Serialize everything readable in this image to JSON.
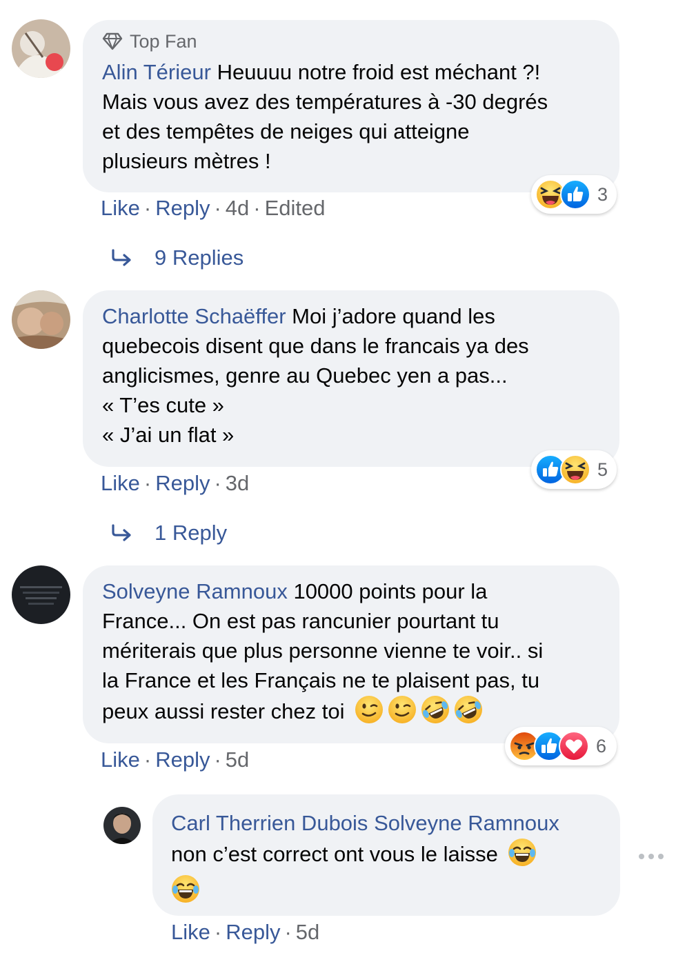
{
  "comments": [
    {
      "badge": "Top Fan",
      "author": "Alin Térieur",
      "text_lines": [
        "Heuuuu notre froid est méchant ?!",
        "Mais vous avez des températures à -30 degrés",
        "et des tempêtes de neiges qui atteigne",
        "plusieurs mètres !"
      ],
      "actions": {
        "like": "Like",
        "reply": "Reply",
        "time": "4d",
        "edited": "Edited"
      },
      "reactions": {
        "icons": [
          "haha-icon",
          "like-icon"
        ],
        "count": "3"
      },
      "replies_label": "9 Replies"
    },
    {
      "author": "Charlotte Schaëffer",
      "text_lines": [
        "Moi j’adore quand les",
        "quebecois disent que dans le francais ya des",
        "anglicismes, genre au Quebec yen a pas...",
        "« T’es cute »",
        "« J’ai un flat »"
      ],
      "actions": {
        "like": "Like",
        "reply": "Reply",
        "time": "3d"
      },
      "reactions": {
        "icons": [
          "like-icon",
          "haha-icon"
        ],
        "count": "5"
      },
      "replies_label": "1 Reply"
    },
    {
      "author": "Solveyne Ramnoux",
      "text_lines": [
        "10000 points pour la",
        "France... On est pas rancunier pourtant tu",
        "mériterais que plus personne vienne te voir.. si",
        "la France et les Français ne te plaisent pas, tu",
        "peux aussi rester chez toi"
      ],
      "trailing_emojis": [
        "wink-emoji",
        "wink-emoji",
        "rofl-emoji",
        "rofl-emoji"
      ],
      "actions": {
        "like": "Like",
        "reply": "Reply",
        "time": "5d"
      },
      "reactions": {
        "icons": [
          "angry-icon",
          "like-icon",
          "love-icon"
        ],
        "count": "6"
      }
    }
  ],
  "reply": {
    "author": "Carl Therrien Dubois",
    "mention": "Solveyne Ramnoux",
    "text": "non c’est correct ont vous le laisse",
    "emojis": [
      "joy-emoji",
      "joy-emoji"
    ],
    "actions": {
      "like": "Like",
      "reply": "Reply",
      "time": "5d"
    }
  },
  "colors": {
    "link": "#385898",
    "meta": "#65676b",
    "bubble": "#f0f2f5",
    "like_blue": "#1877f2"
  }
}
